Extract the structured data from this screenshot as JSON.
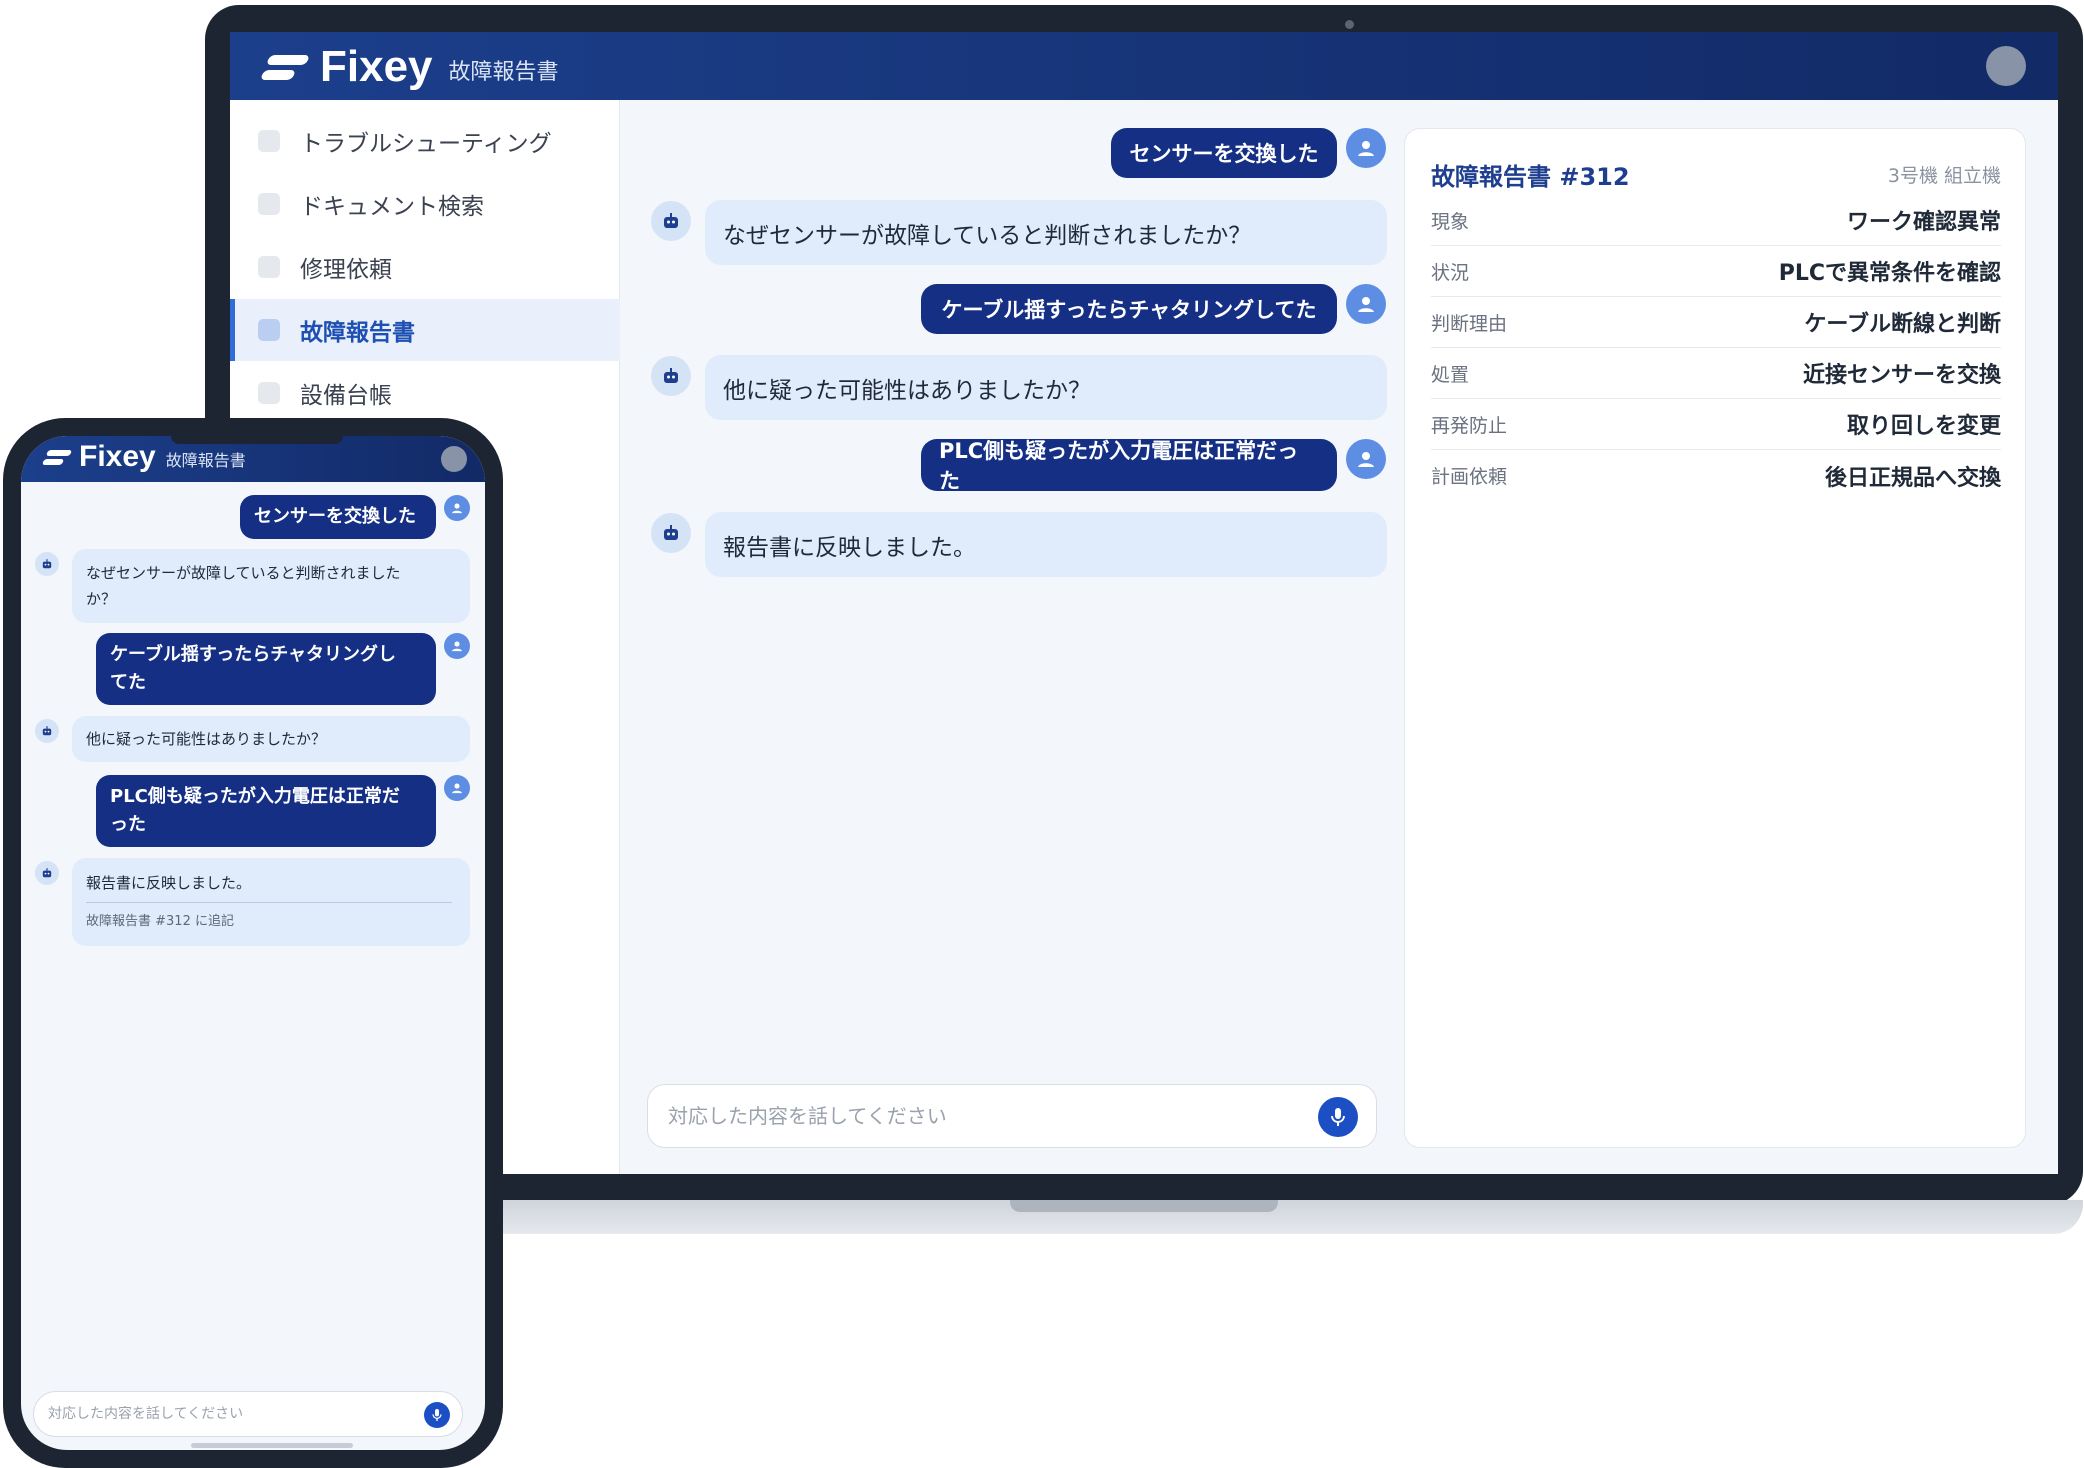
{
  "app": {
    "name": "Fixey",
    "section": "故障報告書"
  },
  "sidebar": {
    "items": [
      {
        "label": "トラブルシューティング",
        "active": false
      },
      {
        "label": "ドキュメント検索",
        "active": false
      },
      {
        "label": "修理依頼",
        "active": false
      },
      {
        "label": "故障報告書",
        "active": true
      },
      {
        "label": "設備台帳",
        "active": false
      }
    ]
  },
  "chat": {
    "messages": [
      {
        "role": "user",
        "text": "センサーを交換した"
      },
      {
        "role": "bot",
        "text": "なぜセンサーが故障していると判断されましたか？"
      },
      {
        "role": "user",
        "text": "ケーブル揺すったらチャタリングしてた"
      },
      {
        "role": "bot",
        "text": "他に疑った可能性はありましたか？"
      },
      {
        "role": "user",
        "text": "PLC側も疑ったが入力電圧は正常だった"
      },
      {
        "role": "bot",
        "text": "報告書に反映しました。"
      }
    ],
    "input_placeholder": "対応した内容を話してください"
  },
  "mobile_chat": {
    "messages": [
      {
        "role": "user",
        "lines": [
          "センサーを交換した"
        ]
      },
      {
        "role": "bot",
        "lines": [
          "なぜセンサーが故障していると判断されました",
          "か？"
        ]
      },
      {
        "role": "user",
        "lines": [
          "ケーブル揺すったらチャタリングし",
          "てた"
        ]
      },
      {
        "role": "bot",
        "lines": [
          "他に疑った可能性はありましたか？"
        ]
      },
      {
        "role": "user",
        "lines": [
          "PLC側も疑ったが入力電圧は正常だ",
          "った"
        ]
      },
      {
        "role": "bot",
        "lines": [
          "報告書に反映しました。"
        ],
        "footnote": "故障報告書 #312 に追記"
      }
    ],
    "input_placeholder": "対応した内容を話してください"
  },
  "report": {
    "title": "故障報告書 #312",
    "machine": "3号機 組立機",
    "fields": [
      {
        "label": "現象",
        "value": "ワーク確認異常"
      },
      {
        "label": "状況",
        "value": "PLCで異常条件を確認"
      },
      {
        "label": "判断理由",
        "value": "ケーブル断線と判断"
      },
      {
        "label": "処置",
        "value": "近接センサーを交換"
      },
      {
        "label": "再発防止",
        "value": "取り回しを変更"
      },
      {
        "label": "計画依頼",
        "value": "後日正規品へ交換"
      }
    ]
  },
  "colors": {
    "header": "#1c3f8c",
    "user_bubble": "#152f85",
    "bot_bubble": "#e0ecfb",
    "accent": "#1d4fc4",
    "report_title": "#1e3f8f"
  },
  "icons": {
    "user": "user-avatar-icon",
    "bot": "robot-icon",
    "mic": "microphone-icon"
  }
}
